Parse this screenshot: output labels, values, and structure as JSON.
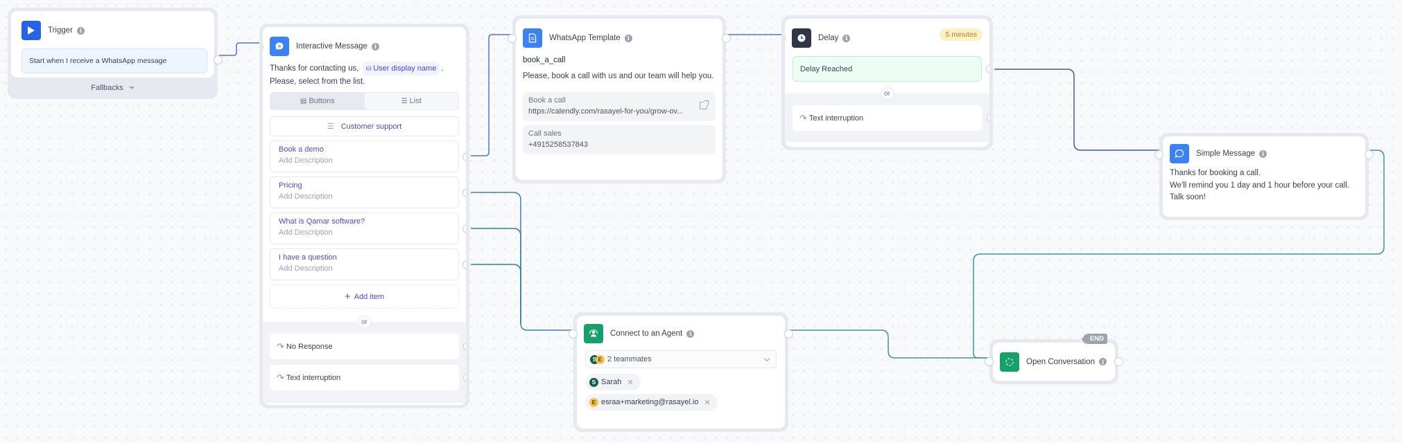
{
  "colors": {
    "blue_accent": "#3b82f6",
    "trigger_icon_bg": "#2563eb",
    "delay_icon_bg": "#2d3748",
    "green_icon_bg": "#16a06a",
    "link_text": "#4f46e5",
    "edge_blue": "#4a78d6",
    "edge_teal": "#2f8a8a",
    "edge_green": "#3f9b7a"
  },
  "trigger": {
    "title": "Trigger",
    "icon": "play-icon",
    "condition": "Start when I receive a WhatsApp message",
    "fallbacks_label": "Fallbacks"
  },
  "interactive_message": {
    "title": "Interactive Message",
    "icon": "chat-bubble-icon",
    "text_before": "Thanks for contacting us,",
    "variable": "User display name",
    "text_after": ".",
    "text_line2": "Please, select from the list.",
    "modes": [
      {
        "label": "Buttons",
        "icon": "buttons-icon",
        "active": false
      },
      {
        "label": "List",
        "icon": "list-icon",
        "active": true
      }
    ],
    "list_button": "Customer support",
    "items": [
      {
        "title": "Book a demo",
        "description": "Add Description"
      },
      {
        "title": "Pricing",
        "description": "Add Description"
      },
      {
        "title": "What is Qamar software?",
        "description": "Add Description"
      },
      {
        "title": "I have a question",
        "description": "Add Description"
      }
    ],
    "add_item": "Add item",
    "or": "or",
    "fallbacks": [
      {
        "label": "No Response",
        "icon": "redirect-icon"
      },
      {
        "label": "Text interruption",
        "icon": "redirect-icon"
      }
    ]
  },
  "whatsapp_template": {
    "title": "WhatsApp Template",
    "icon": "document-icon",
    "name": "book_a_call",
    "body": "Please, book a call with us and our team will help you.",
    "buttons": [
      {
        "label": "Book a call",
        "value": "https://calendly.com/rasayel-for-you/grow-ov...",
        "icon": "external-link-icon"
      },
      {
        "label": "Call sales",
        "value": "+4915258537843"
      }
    ]
  },
  "delay": {
    "title": "Delay",
    "icon": "clock-icon",
    "duration": "5 minutes",
    "reached": "Delay Reached",
    "or": "or",
    "fallback": "Text interruption"
  },
  "simple_message": {
    "title": "Simple Message",
    "icon": "chat-bubble-icon",
    "lines": [
      "Thanks for booking a call.",
      "We'll remind you 1 day and 1 hour before your call.",
      "Talk soon!"
    ]
  },
  "connect_agent": {
    "title": "Connect to an Agent",
    "icon": "agent-icon",
    "summary": "2 teammates",
    "teammates": [
      {
        "initial": "S",
        "name": "Sarah"
      },
      {
        "initial": "E",
        "name": "esraa+marketing@rasayel.io"
      }
    ]
  },
  "open_conversation": {
    "title": "Open Conversation",
    "icon": "open-conversation-icon",
    "end_tag": "END"
  },
  "edges": [
    {
      "from": "trigger",
      "to": "interactive_message"
    },
    {
      "from": "interactive_message.items.0",
      "to": "whatsapp_template"
    },
    {
      "from": "interactive_message.items.1",
      "to": "connect_agent"
    },
    {
      "from": "interactive_message.items.2",
      "to": "connect_agent"
    },
    {
      "from": "interactive_message.items.3",
      "to": "connect_agent"
    },
    {
      "from": "whatsapp_template",
      "to": "delay"
    },
    {
      "from": "delay.reached",
      "to": "simple_message"
    },
    {
      "from": "simple_message",
      "to": "open_conversation"
    },
    {
      "from": "connect_agent",
      "to": "open_conversation"
    }
  ]
}
